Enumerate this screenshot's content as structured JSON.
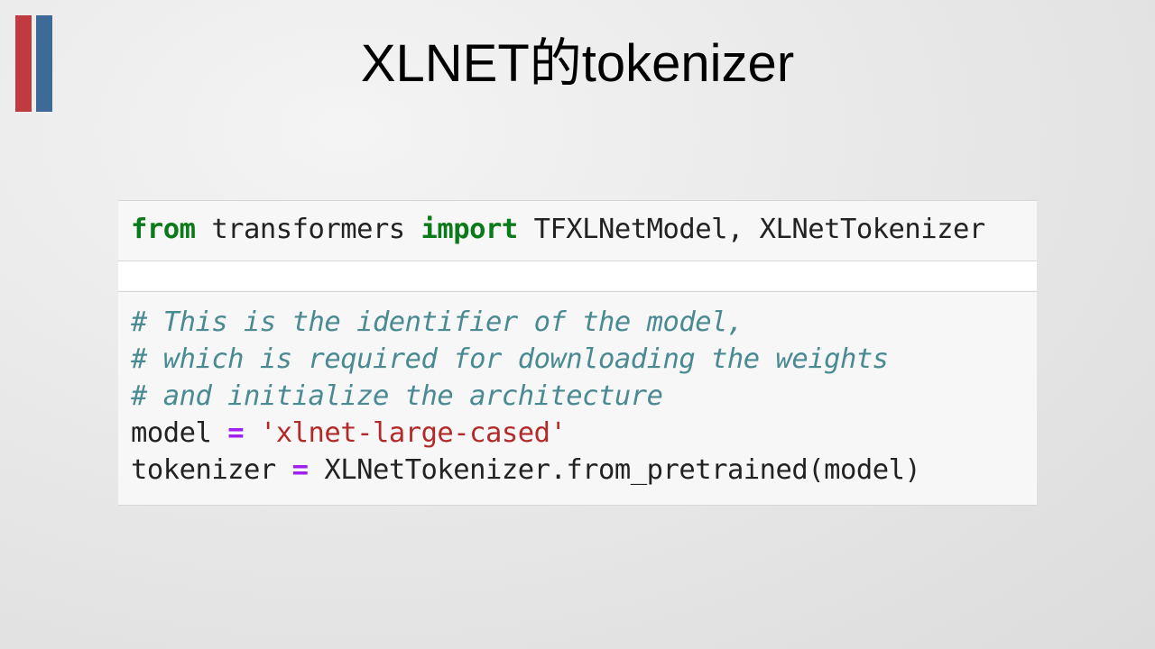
{
  "slide": {
    "title": "XLNET的tokenizer"
  },
  "cells": {
    "import": {
      "kw_from": "from",
      "module": " transformers ",
      "kw_import": "import",
      "names": " TFXLNetModel, XLNetTokenizer"
    },
    "main": {
      "comment1": "# This is the identifier of the model,",
      "comment2": "# which is required for downloading the weights",
      "comment3": "# and initialize the architecture",
      "model_var": "model ",
      "model_eq": "=",
      "model_space": " ",
      "model_value": "'xlnet-large-cased'",
      "tok_var": "tokenizer ",
      "tok_eq": "=",
      "tok_rhs": " XLNetTokenizer.from_pretrained(model)"
    }
  },
  "colors": {
    "accent_red": "#bf3b40",
    "accent_blue": "#3d6a96",
    "keyword": "#0b7a1a",
    "comment": "#4a8a92",
    "operator": "#a020f0",
    "string": "#b22a2a"
  }
}
